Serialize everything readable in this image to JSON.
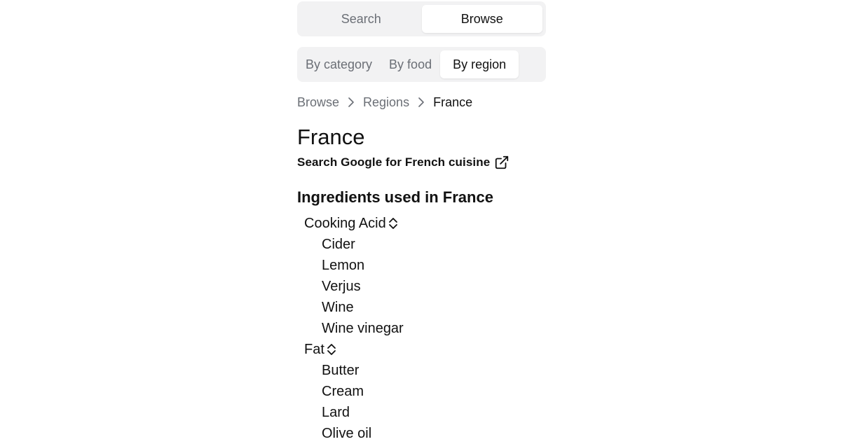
{
  "tabs": {
    "search": "Search",
    "browse": "Browse"
  },
  "subtabs": {
    "category": "By category",
    "food": "By food",
    "region": "By region"
  },
  "breadcrumb": {
    "browse": "Browse",
    "regions": "Regions",
    "current": "France"
  },
  "page": {
    "title": "France",
    "external_link": "Search Google for French cuisine",
    "section_title": "Ingredients used in France"
  },
  "groups": [
    {
      "name": "Cooking Acid",
      "items": [
        "Cider",
        "Lemon",
        "Verjus",
        "Wine",
        "Wine vinegar"
      ]
    },
    {
      "name": "Fat",
      "items": [
        "Butter",
        "Cream",
        "Lard",
        "Olive oil"
      ]
    }
  ],
  "icons": {
    "breadcrumb_separator": "chevron-right-icon",
    "external_link": "external-link-icon",
    "group_toggle": "chevron-up-down-icon"
  }
}
